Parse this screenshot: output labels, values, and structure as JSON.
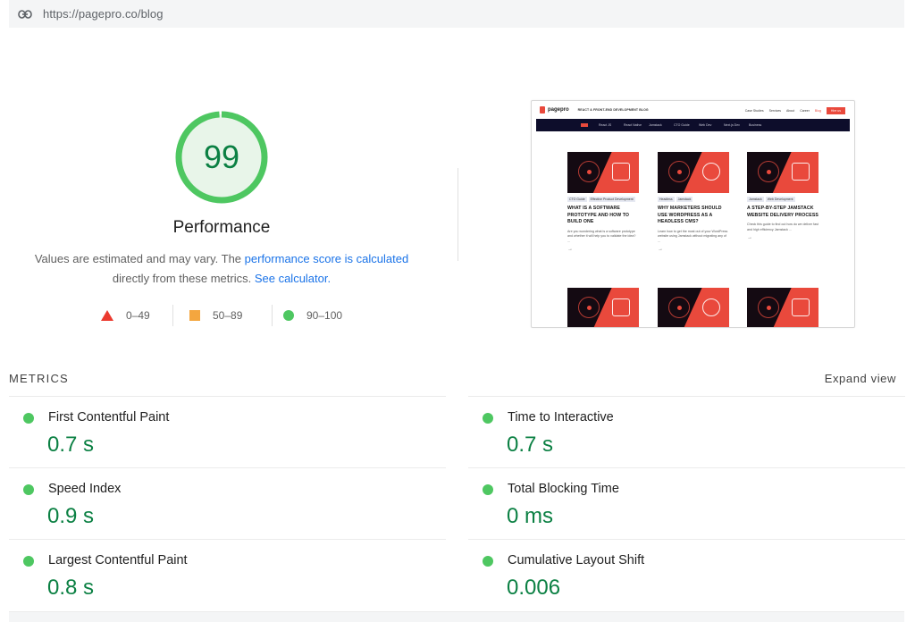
{
  "url_bar": {
    "icon": "link-icon",
    "url": "https://pagepro.co/blog"
  },
  "performance": {
    "score": "99",
    "title": "Performance",
    "desc_prefix": "Values are estimated and may vary. The ",
    "desc_link1": "performance score is calculated",
    "desc_middle": "directly from these metrics. ",
    "desc_link2": "See calculator.",
    "score_fraction": 0.99,
    "colors": {
      "pass": "#0b8043",
      "pass_fill": "#e8f5e9",
      "ring": "#4ec761"
    }
  },
  "legend": [
    {
      "icon": "triangle-fail-icon",
      "label": "0–49",
      "color": "#eb3a2f"
    },
    {
      "icon": "square-average-icon",
      "label": "50–89",
      "color": "#f4a63f"
    },
    {
      "icon": "circle-pass-icon",
      "label": "90–100",
      "color": "#4ec761"
    }
  ],
  "screenshot": {
    "brand": "pagepro",
    "tagline": "REACT & FRONT-END DEVELOPMENT BLOG",
    "links": [
      "Case Studies",
      "Services",
      "About",
      "Career",
      "Blog",
      "Hire us"
    ],
    "nav": [
      "React JS",
      "React Native",
      "Jamstack",
      "CTO Guide",
      "Web Dev",
      "Next.js Dev",
      "Business"
    ],
    "cards": [
      {
        "tags": [
          "CTO Guide",
          "Effective Product Development"
        ],
        "title": "WHAT IS A SOFTWARE PROTOTYPE AND HOW TO BUILD ONE",
        "excerpt": "Are you wondering what is a software prototype and whether it will help you to validate the idea? ...",
        "arrow": "→"
      },
      {
        "tags": [
          "Headless",
          "Jamstack"
        ],
        "title": "WHY MARKETERS SHOULD USE WORDPRESS AS A HEADLESS CMS?",
        "excerpt": "Learn how to get the most out of your WordPress website using Jamstack without migrating any of ...",
        "arrow": "→"
      },
      {
        "tags": [
          "Jamstack",
          "Web Development"
        ],
        "title": "A STEP-BY-STEP JAMSTACK WEBSITE DELIVERY PROCESS",
        "excerpt": "Check this guide to find out how do we deliver fast and high efficiency Jamstack ...",
        "arrow": "→"
      }
    ]
  },
  "metrics": {
    "heading": "METRICS",
    "expand_label": "Expand view",
    "items": [
      {
        "name": "First Contentful Paint",
        "value": "0.7 s"
      },
      {
        "name": "Time to Interactive",
        "value": "0.7 s"
      },
      {
        "name": "Speed Index",
        "value": "0.9 s"
      },
      {
        "name": "Total Blocking Time",
        "value": "0 ms"
      },
      {
        "name": "Largest Contentful Paint",
        "value": "0.8 s"
      },
      {
        "name": "Cumulative Layout Shift",
        "value": "0.006"
      }
    ]
  }
}
